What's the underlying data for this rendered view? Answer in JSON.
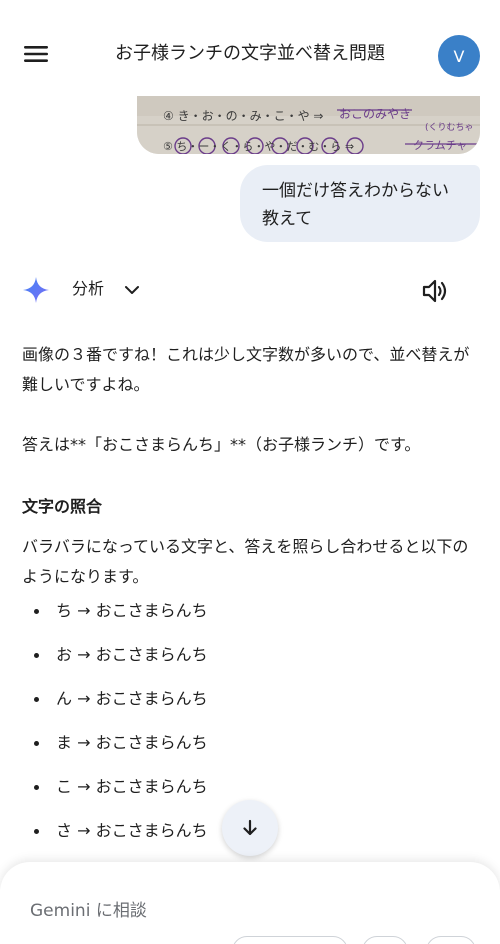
{
  "header": {
    "title": "お子様ランチの文字並べ替え問題",
    "avatar_initial": "V"
  },
  "photo": {
    "row4": "④ き・お・の・み・こ・や ⇒",
    "row4_answer": "おこのみやき",
    "row4_note": "(くりむちゃ",
    "row5": "⑤ ち・ー・く・ら・や・だ・む・ら ⇒",
    "row5_answer": "クラムチャ"
  },
  "user_message": {
    "text": "一個だけ答えわからない教えて"
  },
  "response": {
    "model_label": "分析",
    "paragraph1": "画像の３番ですね！これは少し文字数が多いので、並べ替えが難しいですよね。",
    "paragraph2": "答えは**「おこさまらんち」**（お子様ランチ）です。",
    "heading": "文字の照合",
    "paragraph3": "バラバラになっている文字と、答えを照らし合わせると以下のようになります。",
    "bullets": [
      "ち → おこさまらんち",
      "お → おこさまらんち",
      "ん → おこさまらんち",
      "ま → おこさまらんち",
      "こ → おこさまらんち",
      "さ → おこさまらんち"
    ]
  },
  "composer": {
    "placeholder": "Gemini に相談"
  },
  "colors": {
    "avatar": "#3a80c8",
    "user_bubble": "#e9eef6",
    "accent_sparkle": "#4285f4"
  }
}
